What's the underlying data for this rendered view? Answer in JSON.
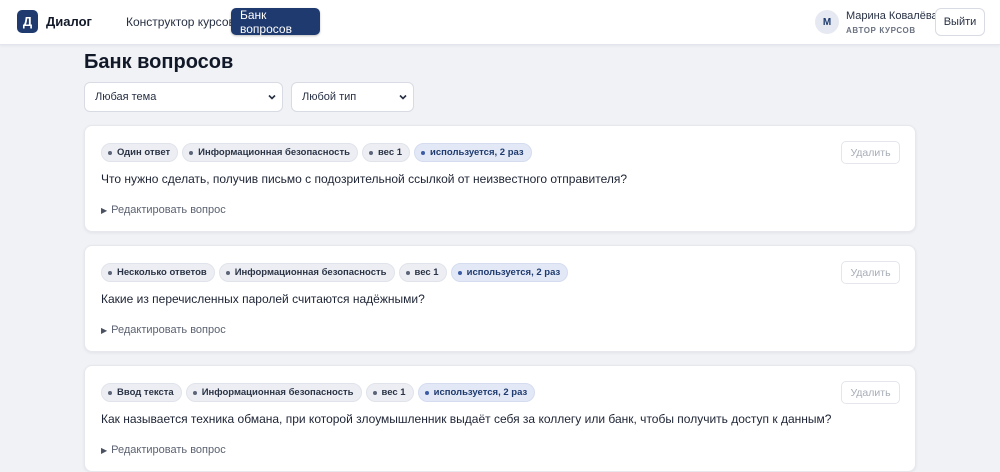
{
  "header": {
    "logo_letter": "Д",
    "app_name": "Диалог",
    "nav": [
      {
        "label": "Конструктор курсов",
        "active": false
      },
      {
        "label": "Банк вопросов",
        "active": true
      }
    ],
    "user": {
      "initial": "М",
      "name": "Марина Ковалёва",
      "role": "АВТОР КУРСОВ"
    },
    "logout_label": "Выйти"
  },
  "page": {
    "title": "Банк вопросов",
    "filters": {
      "topic": "Любая тема",
      "type": "Любой тип"
    }
  },
  "questions": [
    {
      "tags": [
        "Один ответ",
        "Информационная безопасность",
        "вес 1",
        "используется, 2 раз"
      ],
      "text": "Что нужно сделать, получив письмо с подозрительной ссылкой от неизвестного отправителя?",
      "edit_label": "Редактировать вопрос",
      "delete_label": "Удалить"
    },
    {
      "tags": [
        "Несколько ответов",
        "Информационная безопасность",
        "вес 1",
        "используется, 2 раз"
      ],
      "text": "Какие из перечисленных паролей считаются надёжными?",
      "edit_label": "Редактировать вопрос",
      "delete_label": "Удалить"
    },
    {
      "tags": [
        "Ввод текста",
        "Информационная безопасность",
        "вес 1",
        "используется, 2 раз"
      ],
      "text": "Как называется техника обмана, при которой злоумышленник выдаёт себя за коллегу или банк, чтобы получить доступ к данным?",
      "edit_label": "Редактировать вопрос",
      "delete_label": "Удалить"
    }
  ],
  "colors": {
    "brand": "#1e3a6e",
    "background": "#f1f2f6",
    "used_tag": "#e2e8f6"
  }
}
